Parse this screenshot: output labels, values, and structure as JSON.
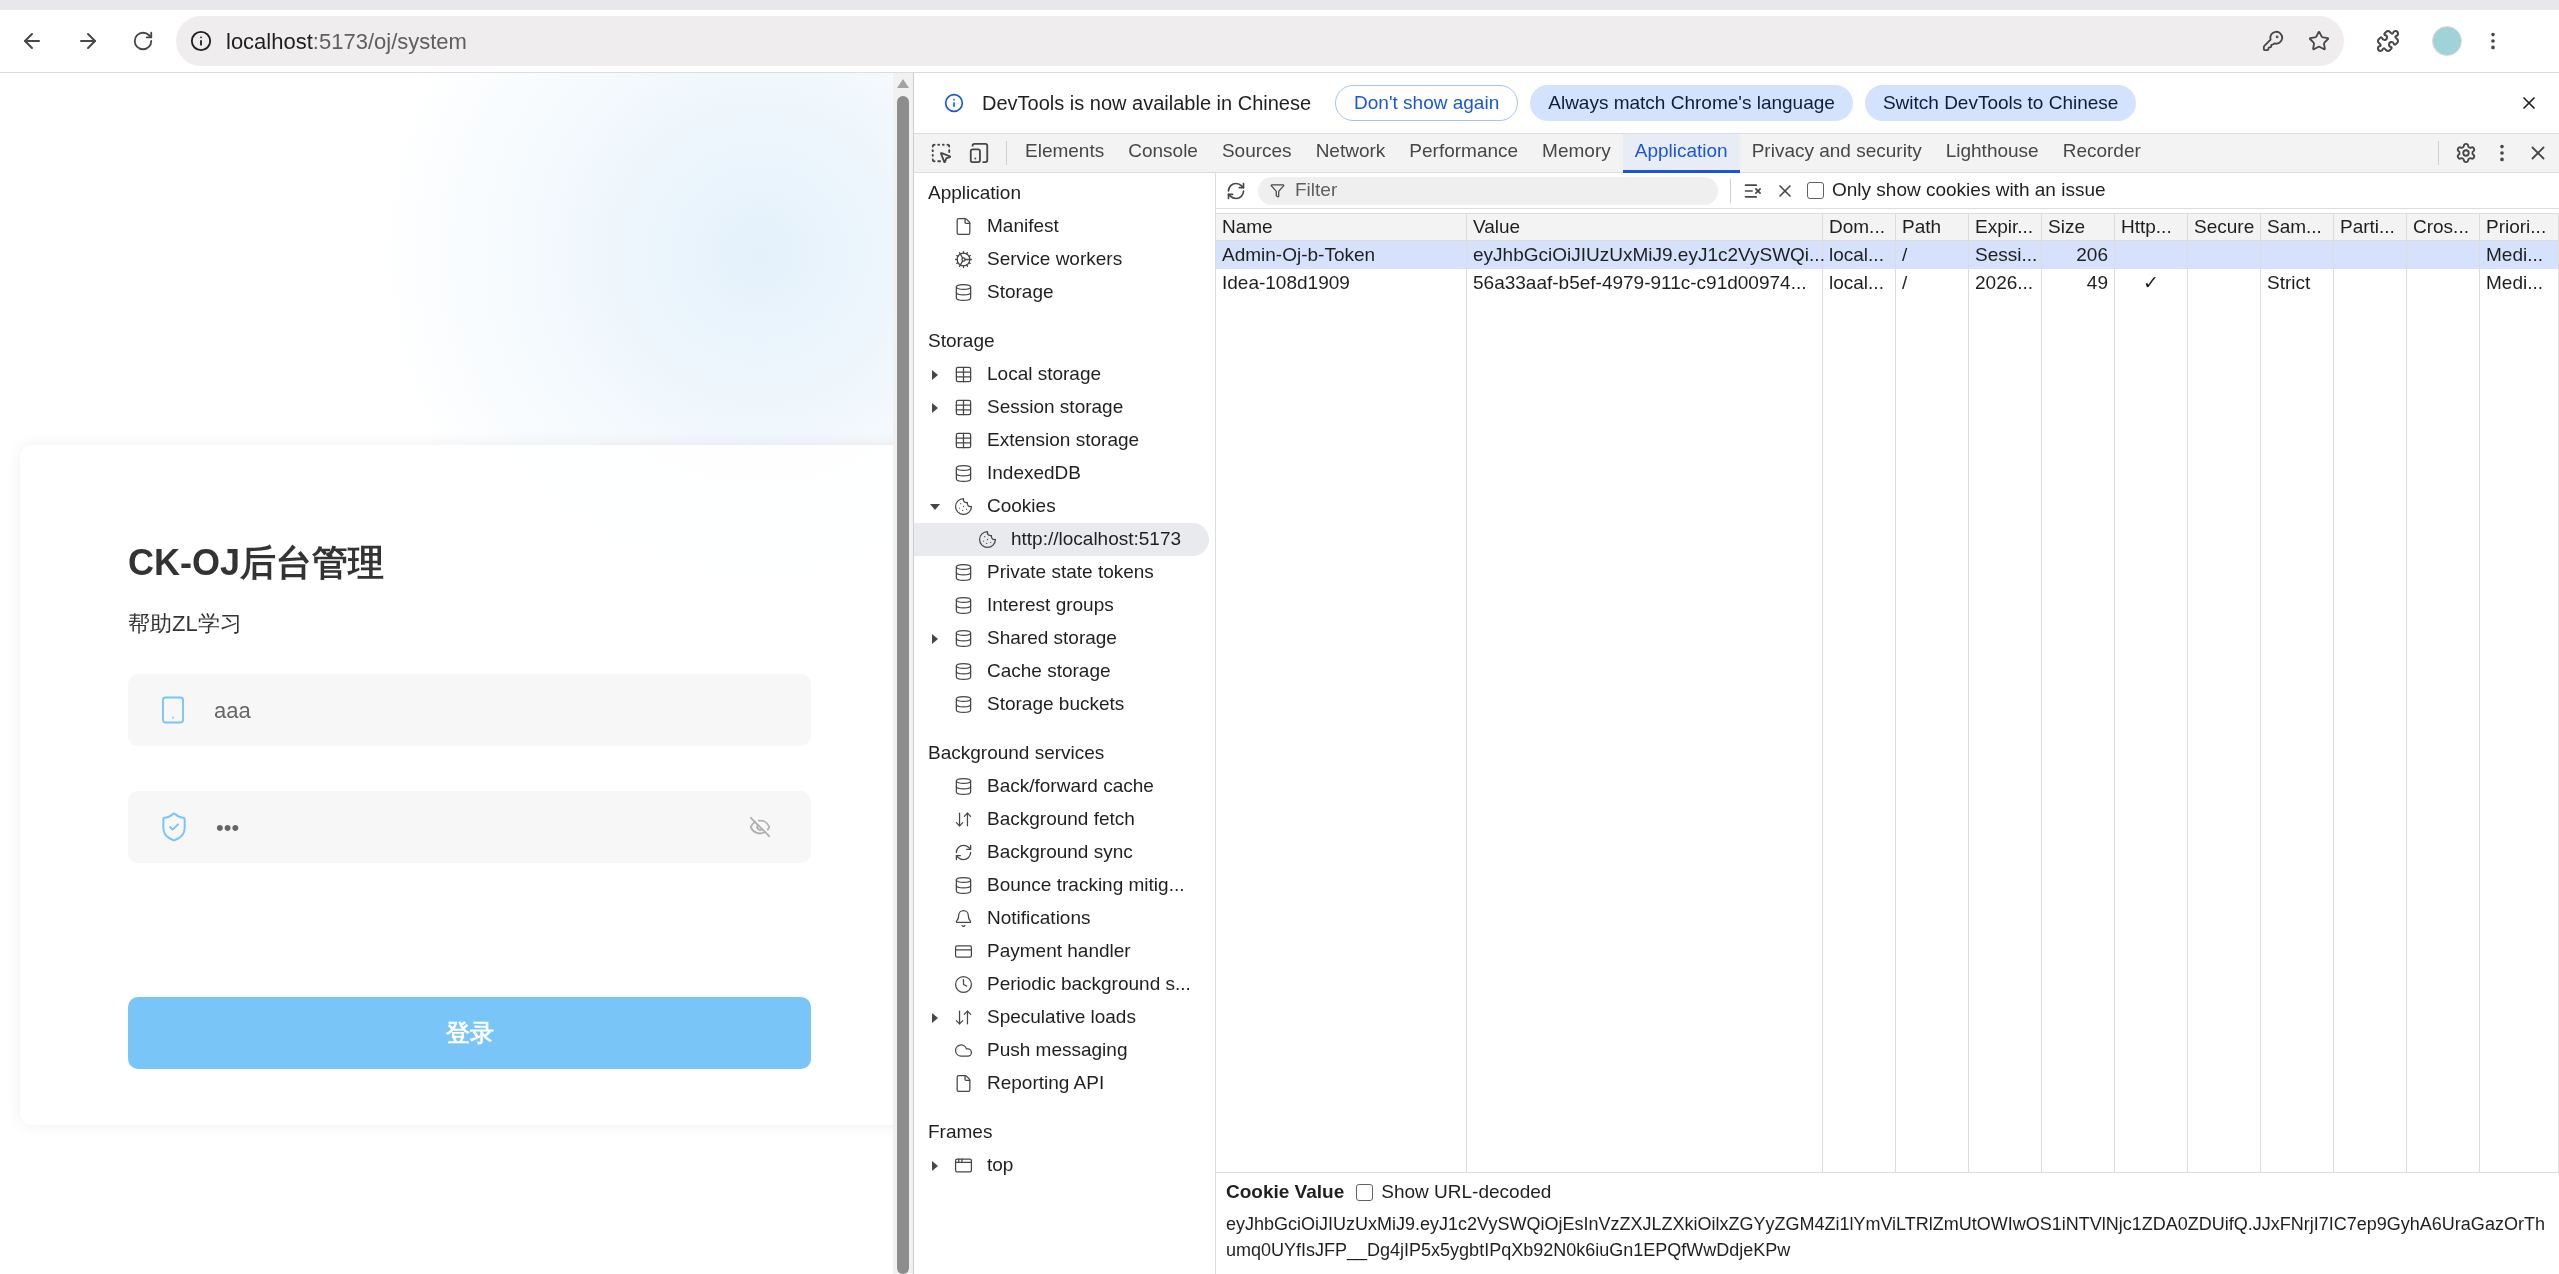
{
  "browser": {
    "url_host": "localhost",
    "url_path": ":5173/oj/system"
  },
  "login": {
    "title": "CK-OJ后台管理",
    "subtitle": "帮助ZL学习",
    "username": "aaa",
    "password": "•••",
    "submit": "登录"
  },
  "devtools": {
    "infobar": {
      "text": "DevTools is now available in Chinese",
      "buttons": [
        {
          "label": "Don't show again",
          "kind": "outline"
        },
        {
          "label": "Always match Chrome's language",
          "kind": "filled"
        },
        {
          "label": "Switch DevTools to Chinese",
          "kind": "filled"
        }
      ]
    },
    "tabs": [
      {
        "label": "Elements",
        "selected": false
      },
      {
        "label": "Console",
        "selected": false
      },
      {
        "label": "Sources",
        "selected": false
      },
      {
        "label": "Network",
        "selected": false
      },
      {
        "label": "Performance",
        "selected": false
      },
      {
        "label": "Memory",
        "selected": false
      },
      {
        "label": "Application",
        "selected": true
      },
      {
        "label": "Privacy and security",
        "selected": false
      },
      {
        "label": "Lighthouse",
        "selected": false
      },
      {
        "label": "Recorder",
        "selected": false
      }
    ],
    "sidebar": [
      {
        "title": "Application",
        "items": [
          {
            "label": "Manifest",
            "kind": "file",
            "selected": false
          },
          {
            "label": "Service workers",
            "kind": "gears",
            "selected": false
          },
          {
            "label": "Storage",
            "kind": "database",
            "selected": false
          }
        ]
      },
      {
        "title": "Storage",
        "items": [
          {
            "label": "Local storage",
            "kind": "table",
            "expanded": false,
            "selected": false
          },
          {
            "label": "Session storage",
            "kind": "table",
            "expanded": false,
            "selected": false
          },
          {
            "label": "Extension storage",
            "kind": "table",
            "selected": false
          },
          {
            "label": "IndexedDB",
            "kind": "database",
            "selected": false
          },
          {
            "label": "Cookies",
            "kind": "cookie",
            "expanded": true,
            "selected": false,
            "children": [
              {
                "label": "http://localhost:5173",
                "kind": "cookie",
                "selected": true
              }
            ]
          },
          {
            "label": "Private state tokens",
            "kind": "database",
            "selected": false
          },
          {
            "label": "Interest groups",
            "kind": "database",
            "selected": false
          },
          {
            "label": "Shared storage",
            "kind": "database",
            "expanded": false,
            "selected": false
          },
          {
            "label": "Cache storage",
            "kind": "database",
            "selected": false
          },
          {
            "label": "Storage buckets",
            "kind": "database",
            "selected": false
          }
        ]
      },
      {
        "title": "Background services",
        "items": [
          {
            "label": "Back/forward cache",
            "kind": "database",
            "selected": false
          },
          {
            "label": "Background fetch",
            "kind": "updown",
            "selected": false
          },
          {
            "label": "Background sync",
            "kind": "sync",
            "selected": false
          },
          {
            "label": "Bounce tracking mitig...",
            "kind": "database",
            "selected": false
          },
          {
            "label": "Notifications",
            "kind": "bell",
            "selected": false
          },
          {
            "label": "Payment handler",
            "kind": "card",
            "selected": false
          },
          {
            "label": "Periodic background s...",
            "kind": "clock",
            "selected": false
          },
          {
            "label": "Speculative loads",
            "kind": "updown",
            "expanded": false,
            "selected": false
          },
          {
            "label": "Push messaging",
            "kind": "cloud",
            "selected": false
          },
          {
            "label": "Reporting API",
            "kind": "file",
            "selected": false
          }
        ]
      },
      {
        "title": "Frames",
        "items": [
          {
            "label": "top",
            "kind": "frame",
            "expanded": false,
            "selected": false
          }
        ]
      }
    ],
    "filter": {
      "placeholder": "Filter"
    },
    "issue_filter": {
      "label": "Only show cookies with an issue",
      "checked": false
    },
    "table": {
      "columns": [
        {
          "label": "Name",
          "kind": "text"
        },
        {
          "label": "Value",
          "kind": "text"
        },
        {
          "label": "Dom...",
          "kind": "text"
        },
        {
          "label": "Path",
          "kind": "text"
        },
        {
          "label": "Expir...",
          "kind": "text"
        },
        {
          "label": "Size",
          "kind": "number"
        },
        {
          "label": "Http...",
          "kind": "center"
        },
        {
          "label": "Secure",
          "kind": "center"
        },
        {
          "label": "Sam...",
          "kind": "text"
        },
        {
          "label": "Parti...",
          "kind": "text"
        },
        {
          "label": "Cros...",
          "kind": "text"
        },
        {
          "label": "Priori...",
          "kind": "text"
        }
      ],
      "rows": [
        {
          "selected": true,
          "cells": [
            "Admin-Oj-b-Token",
            "eyJhbGciOiJIUzUxMiJ9.eyJ1c2VySWQi...",
            "local...",
            "/",
            "Sessi...",
            "206",
            "",
            "",
            "",
            "",
            "",
            "Medi..."
          ]
        },
        {
          "selected": false,
          "cells": [
            "Idea-108d1909",
            "56a33aaf-b5ef-4979-911c-c91d00974...",
            "local...",
            "/",
            "2026...",
            "49",
            "✓",
            "",
            "Strict",
            "",
            "",
            "Medi..."
          ]
        }
      ]
    },
    "cookie_value": {
      "label": "Cookie Value",
      "decode_label": "Show URL-decoded",
      "decode_checked": false,
      "value": "eyJhbGciOiJIUzUxMiJ9.eyJ1c2VySWQiOjEsInVzZXJLZXkiOilxZGYyZGM4Zi1lYmViLTRlZmUtOWIwOS1iNTVlNjc1ZDA0ZDUifQ.JJxFNrjI7IC7ep9GyhA6UraGazOrThumq0UYfIsJFP__Dg4jIP5x5ygbtIPqXb92N0k6iuGn1EPQfWwDdjeKPw"
    }
  }
}
